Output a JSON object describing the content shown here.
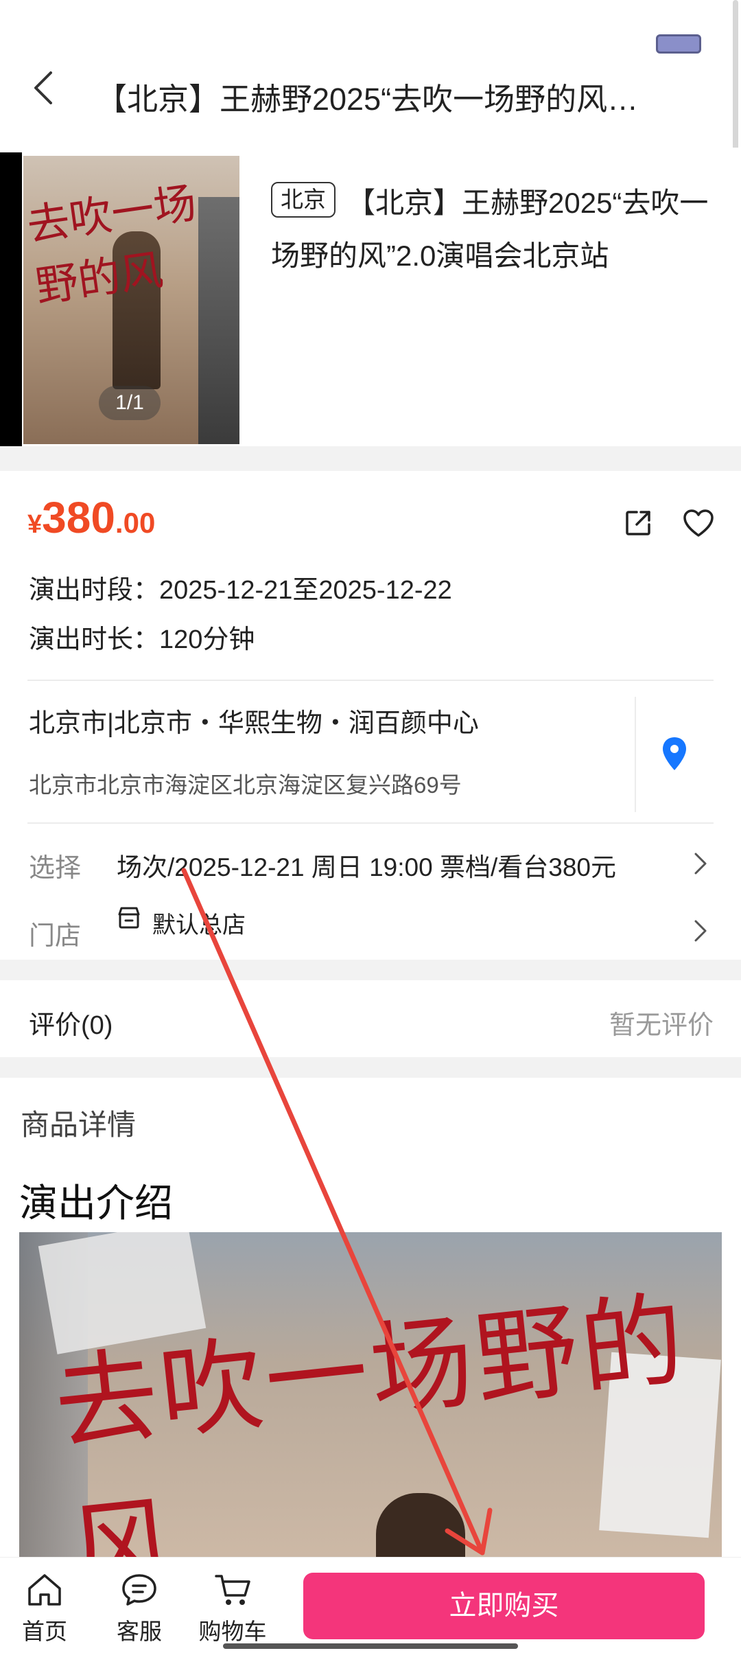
{
  "header": {
    "title": "【北京】王赫野2025“去吹一场野的风…"
  },
  "product": {
    "poster_title": "去吹一场野的风",
    "image_counter": "1/1",
    "city_tag": "北京",
    "name": "【北京】王赫野2025“去吹一场野的风”2.0演唱会北京站"
  },
  "price": {
    "currency": "¥",
    "integer": "380",
    "decimal": ".00"
  },
  "show": {
    "period_label": "演出时段：",
    "period_value": "2025-12-21至2025-12-22",
    "duration_label": "演出时长：",
    "duration_value": "120分钟"
  },
  "venue": {
    "name": "北京市|北京市・华熙生物・润百颜中心",
    "address": "北京市北京市海淀区北京海淀区复兴路69号"
  },
  "selection": {
    "label": "选择",
    "value": "场次/2025-12-21 周日 19:00 票档/看台380元"
  },
  "store": {
    "label": "门店",
    "value": "默认总店"
  },
  "reviews": {
    "label": "评价(0)",
    "empty": "暂无评价"
  },
  "details": {
    "heading": "商品详情",
    "intro_heading": "演出介绍",
    "banner_title": "去吹一场野的风"
  },
  "bottom_nav": {
    "home": "首页",
    "service": "客服",
    "cart": "购物车",
    "buy": "立即购买"
  },
  "colors": {
    "price": "#f04a24",
    "buy_button": "#f4357b",
    "location_pin": "#1677ff",
    "annotation_arrow": "#e8453c"
  },
  "icons": [
    "back-arrow-icon",
    "share-icon",
    "heart-icon",
    "location-pin-icon",
    "chevron-right-icon",
    "store-icon",
    "home-icon",
    "chat-service-icon",
    "cart-icon"
  ]
}
